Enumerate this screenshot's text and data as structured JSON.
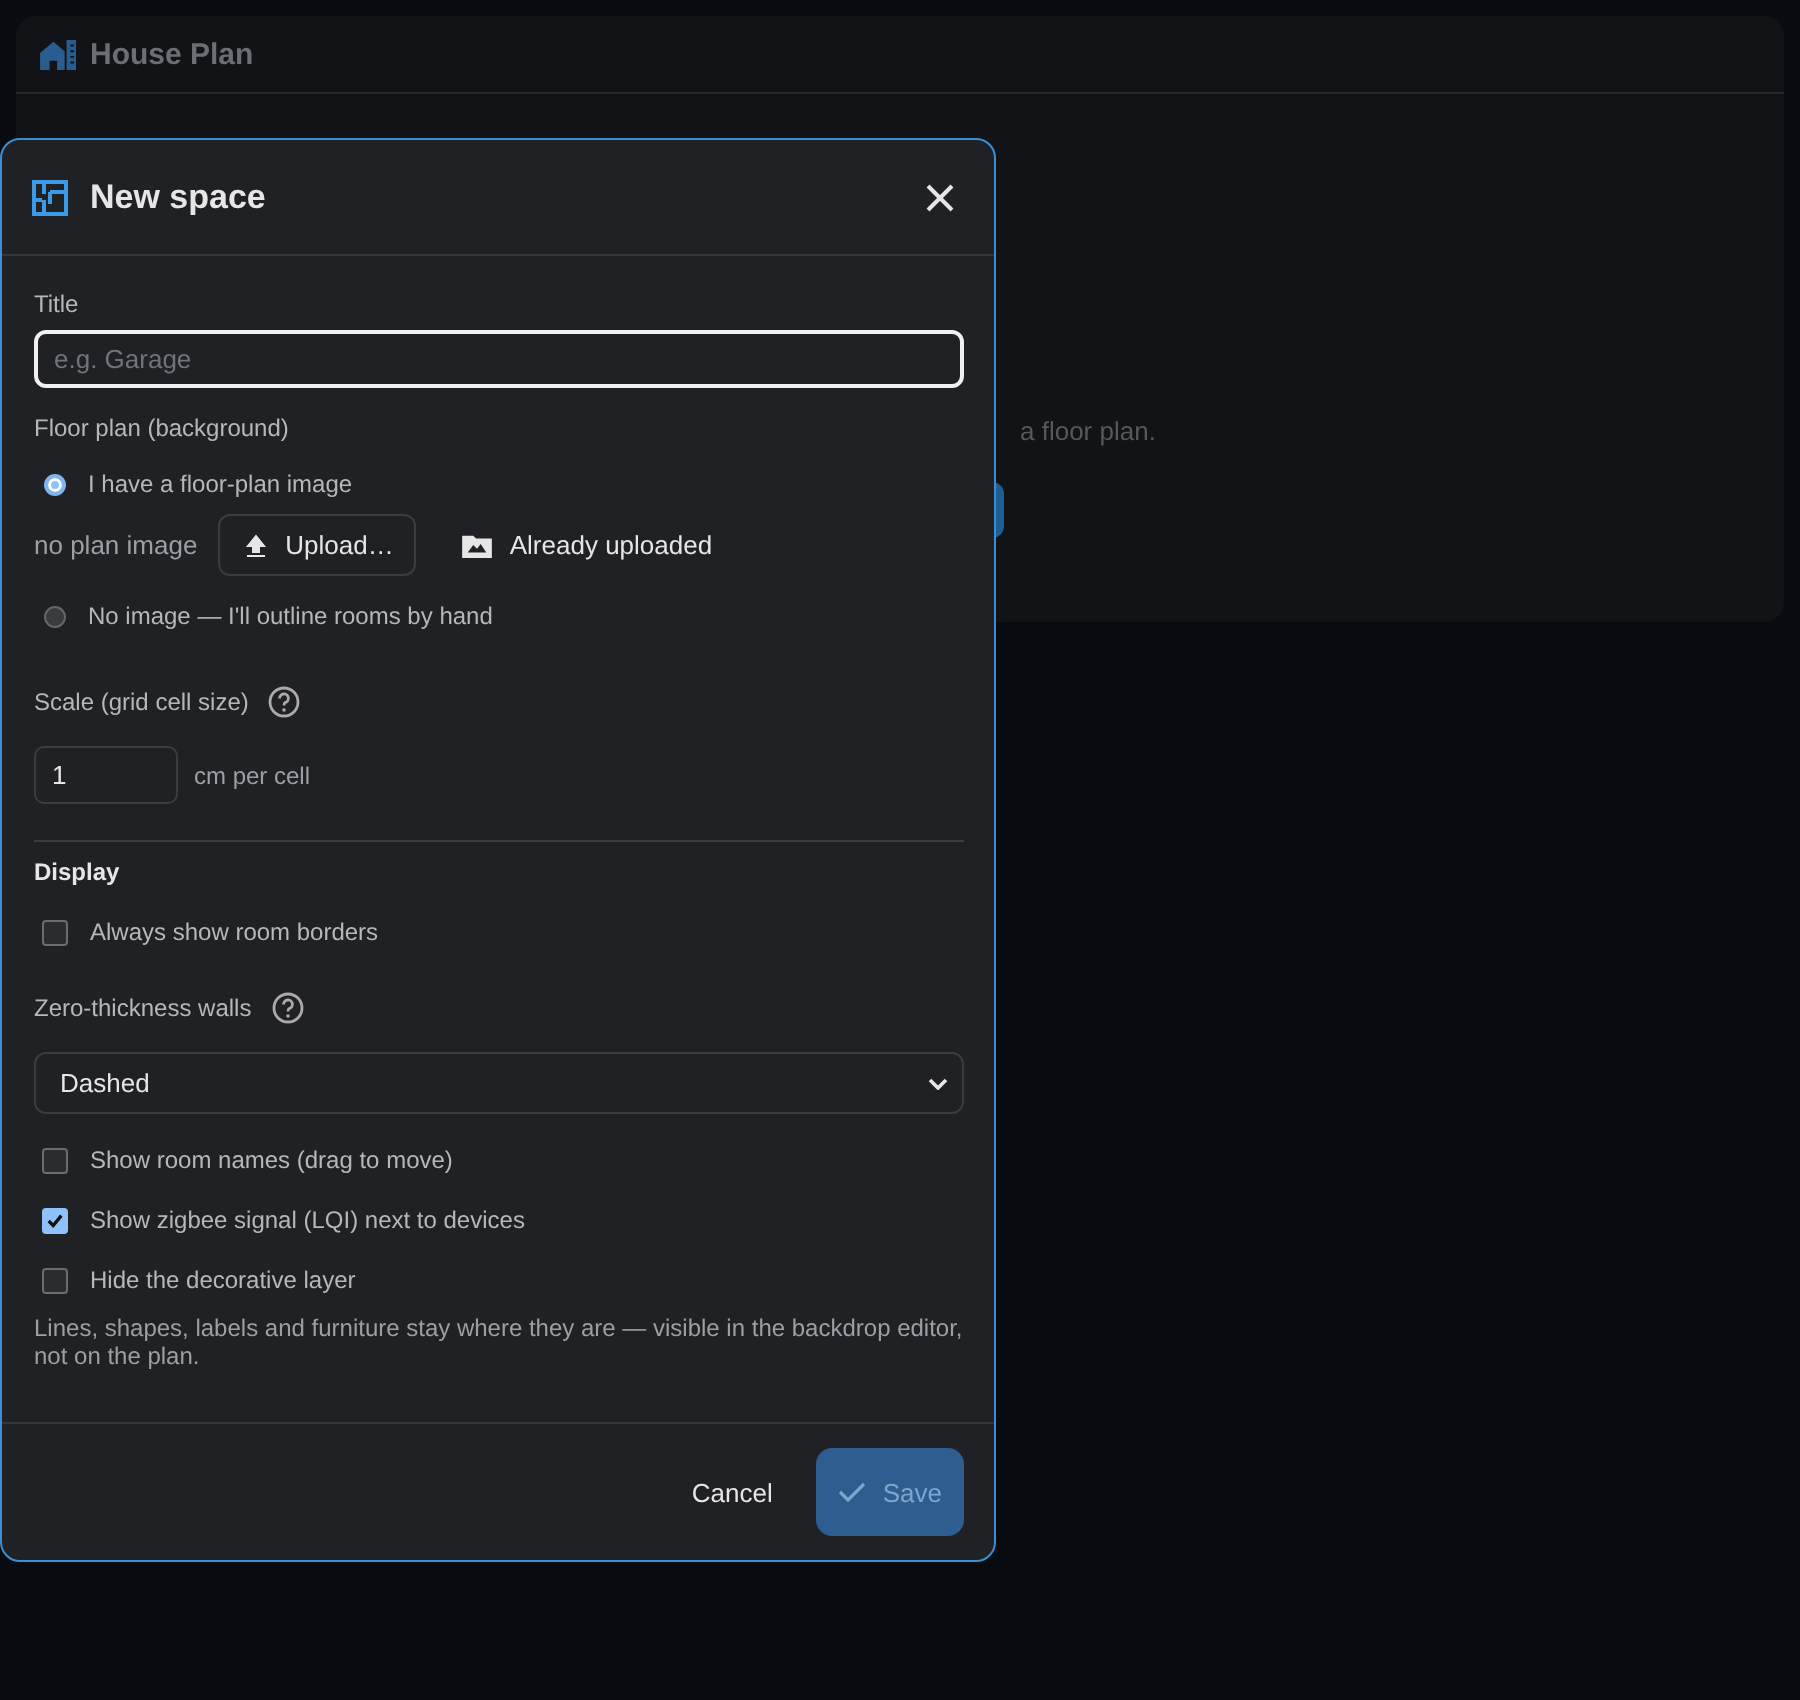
{
  "app": {
    "title": "House Plan",
    "hint": "a floor plan."
  },
  "dialog": {
    "title": "New space",
    "title_field": {
      "label": "Title",
      "placeholder": "e.g. Garage"
    },
    "floor_plan": {
      "label": "Floor plan (background)",
      "options": [
        {
          "label": "I have a floor-plan image",
          "selected": true
        },
        {
          "label": "No image — I'll outline rooms by hand",
          "selected": false
        }
      ],
      "image_status": "no plan image",
      "upload_button": "Upload…",
      "uploaded_button": "Already uploaded"
    },
    "scale": {
      "label": "Scale (grid cell size)",
      "value": "1",
      "unit": "cm per cell"
    },
    "display": {
      "heading": "Display",
      "items": [
        {
          "kind": "checkbox",
          "label": "Always show room borders",
          "checked": false
        },
        {
          "kind": "select",
          "label": "Zero-thickness walls",
          "value": "Dashed"
        },
        {
          "kind": "checkbox",
          "label": "Show room names (drag to move)",
          "checked": false
        },
        {
          "kind": "checkbox",
          "label": "Show zigbee signal (LQI) next to devices",
          "checked": true
        },
        {
          "kind": "checkbox",
          "label": "Hide the decorative layer",
          "checked": false
        }
      ],
      "note": "Lines, shapes, labels and furniture stay where they are — visible in the backdrop editor, not on the plan."
    },
    "cancel": "Cancel",
    "save": {
      "label": "Save",
      "disabled": true
    }
  }
}
